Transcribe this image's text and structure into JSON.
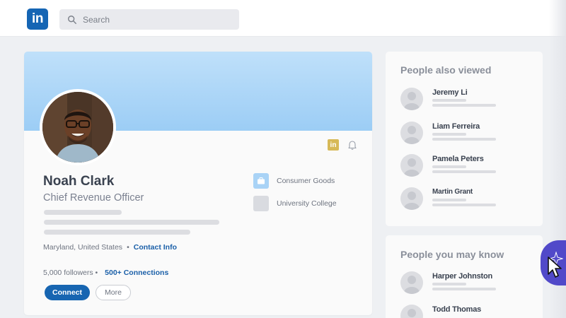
{
  "header": {
    "logo_text": "in",
    "search": {
      "placeholder": "Search",
      "value": ""
    }
  },
  "profile": {
    "name": "Noah Clark",
    "headline": "Chief Revenue Officer",
    "location": "Maryland, United States",
    "location_separator": "•",
    "contact_info_label": "Contact Info",
    "followers": "5,000 followers",
    "followers_separator": "•",
    "connections_label": "500+ Connections",
    "connect_button": "Connect",
    "more_button": "More",
    "badge_text": "in",
    "experience": [
      {
        "label": "Consumer Goods",
        "icon": "briefcase-icon"
      },
      {
        "label": "University College",
        "icon": "school-icon"
      }
    ]
  },
  "people_also_viewed": {
    "title": "People also viewed",
    "people": [
      {
        "name": "Jeremy Li"
      },
      {
        "name": "Liam Ferreira"
      },
      {
        "name": "Pamela Peters"
      },
      {
        "name": "Martin Grant"
      }
    ]
  },
  "people_you_may_know": {
    "title": "People you may know",
    "people": [
      {
        "name": "Harper Johnston"
      },
      {
        "name": "Todd Thomas"
      }
    ]
  },
  "colors": {
    "brand_blue": "#1565b4",
    "link_blue": "#1a5fa8",
    "banner_top": "#bfe0fa",
    "banner_bottom": "#9ccdf5",
    "extension_purple": "#5149c9",
    "badge_gold": "#d7b957"
  },
  "icons": [
    "search-icon",
    "bell-icon",
    "linkedin-logo",
    "briefcase-icon",
    "person-placeholder-icon",
    "cursor-icon"
  ]
}
